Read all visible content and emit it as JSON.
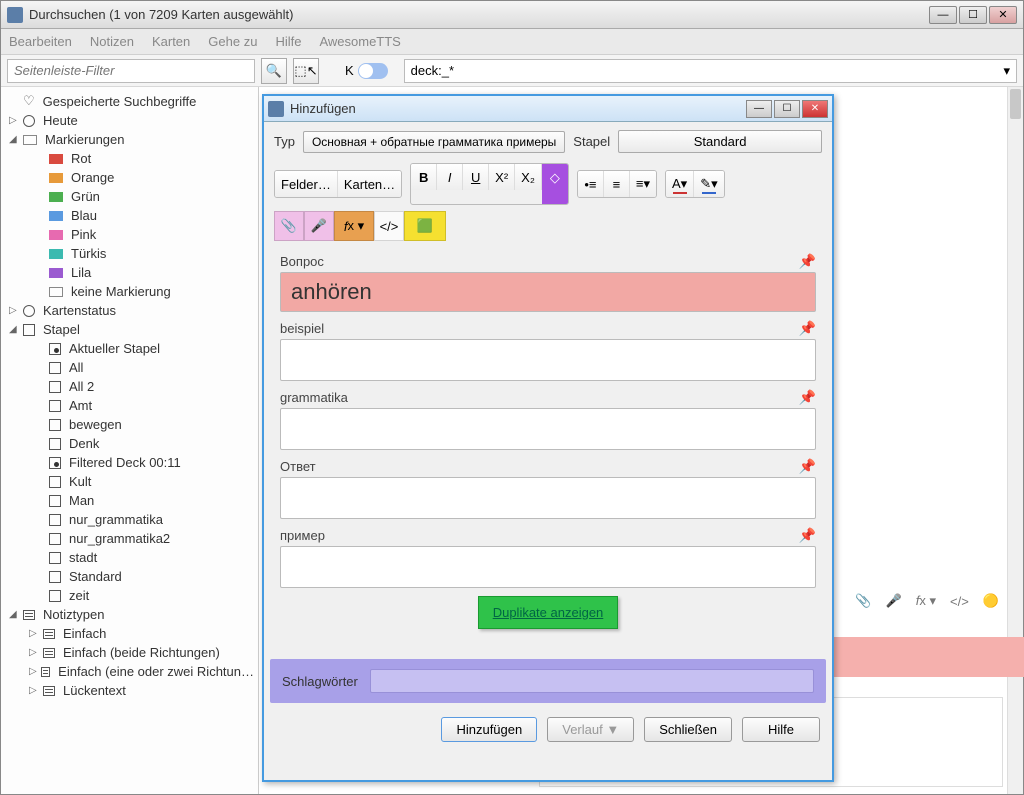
{
  "window": {
    "title": "Durchsuchen (1 von 7209 Karten ausgewählt)"
  },
  "menubar": [
    "Bearbeiten",
    "Notizen",
    "Karten",
    "Gehe zu",
    "Hilfe",
    "AwesomeTTS"
  ],
  "sidebar_filter_placeholder": "Seitenleiste-Filter",
  "deck_search": "deck:_*",
  "sidebar": {
    "saved": "Gespeicherte Suchbegriffe",
    "today": "Heute",
    "flags_label": "Markierungen",
    "flags": [
      {
        "label": "Rot",
        "class": "red"
      },
      {
        "label": "Orange",
        "class": "orange"
      },
      {
        "label": "Grün",
        "class": "green"
      },
      {
        "label": "Blau",
        "class": "blue"
      },
      {
        "label": "Pink",
        "class": "pink"
      },
      {
        "label": "Türkis",
        "class": "turk"
      },
      {
        "label": "Lila",
        "class": "lila"
      },
      {
        "label": "keine Markierung",
        "class": "none"
      }
    ],
    "cardstate": "Kartenstatus",
    "decks_label": "Stapel",
    "decks": [
      "Aktueller Stapel",
      "All",
      "All 2",
      "Amt",
      "bewegen",
      "Denk",
      "Filtered Deck 00:11",
      "Kult",
      "Man",
      "nur_grammatika",
      "nur_grammatika2",
      "stadt",
      "Standard",
      "zeit"
    ],
    "notetypes_label": "Notiztypen",
    "notetypes": [
      "Einfach",
      "Einfach (beide Richtungen)",
      "Einfach (eine oder zwei Richtun…",
      "Lückentext"
    ]
  },
  "dialog": {
    "title": "Hinzufügen",
    "type_label": "Typ",
    "type_value": "Основная + обратные грамматика примеры",
    "stack_label": "Stapel",
    "stack_value": "Standard",
    "fields_btn": "Felder…",
    "cards_btn": "Karten…",
    "fields": {
      "q_label": "Вопрос",
      "q_value": "anhören",
      "ex_label": "beispiel",
      "gram_label": "grammatika",
      "a_label": "Ответ",
      "ex2_label": "пример"
    },
    "dup_btn": "Duplikate anzeigen",
    "tags_label": "Schlagwörter",
    "buttons": {
      "add": "Hinzufügen",
      "history": "Verlauf ▼",
      "close": "Schließen",
      "help": "Hilfe"
    }
  }
}
